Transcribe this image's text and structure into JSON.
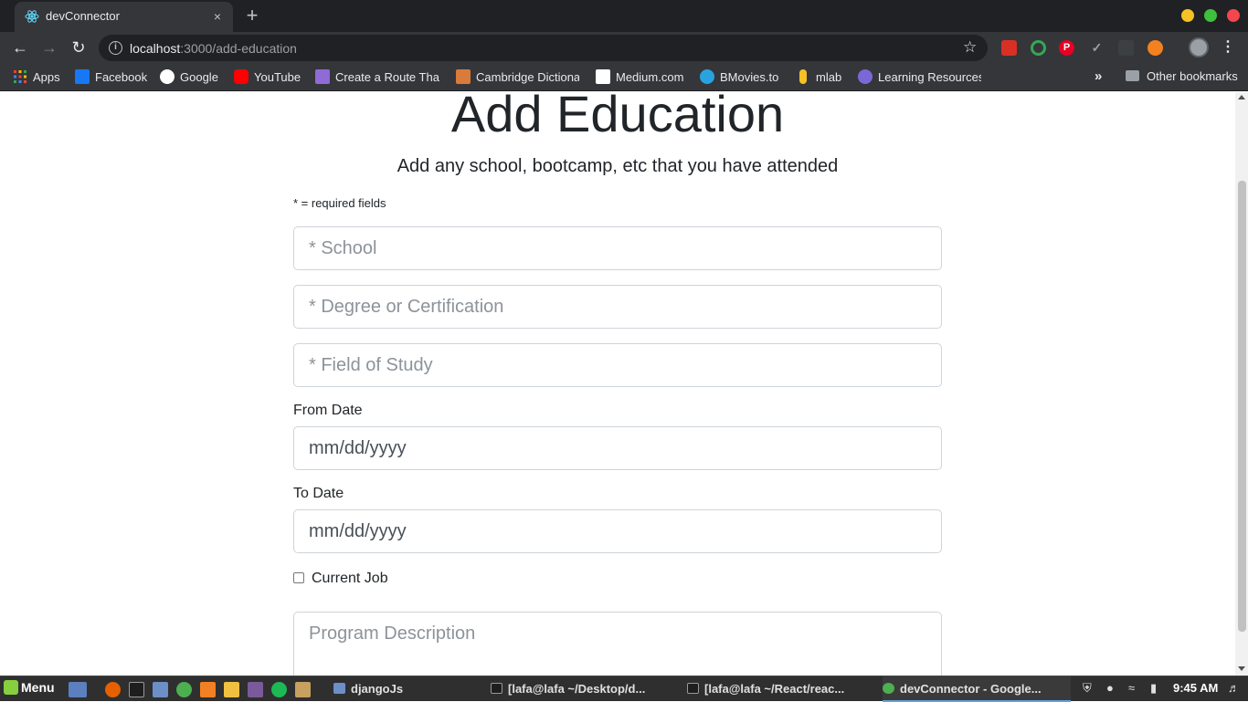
{
  "browser": {
    "tab_title": "devConnector",
    "tab_close": "×",
    "new_tab": "+",
    "url_host": "localhost",
    "url_rest": ":3000/add-education",
    "icons": {
      "back": "arrow-left",
      "forward": "arrow-right",
      "reload": "reload",
      "star": "star",
      "menu": "kebab"
    }
  },
  "bookmarks": [
    {
      "label": "Apps",
      "icon_color": "#ea4335"
    },
    {
      "label": "Facebook",
      "icon_color": "#1877f2"
    },
    {
      "label": "Google",
      "icon_color": "#ffffff"
    },
    {
      "label": "YouTube",
      "icon_color": "#ff0000"
    },
    {
      "label": "Create a Route That",
      "icon_color": "#8e6bd6"
    },
    {
      "label": "Cambridge Dictiona",
      "icon_color": "#d97b3a"
    },
    {
      "label": "Medium.com",
      "icon_color": "#ffffff"
    },
    {
      "label": "BMovies.to",
      "icon_color": "#29a3e0"
    },
    {
      "label": "mlab",
      "icon_color": "#f5c225"
    },
    {
      "label": "Learning Resources",
      "icon_color": "#7b68d6"
    }
  ],
  "bookmarks_more": "»",
  "bookmarks_other": "Other bookmarks",
  "page": {
    "heading": "Add Education",
    "lead": "Add any school, bootcamp, etc that you have attended",
    "required_note": "* = required fields",
    "school_placeholder": "* School",
    "degree_placeholder": "* Degree or Certification",
    "field_of_study_placeholder": "* Field of Study",
    "from_label": "From Date",
    "from_value": "mm/dd/yyyy",
    "to_label": "To Date",
    "to_value": "mm/dd/yyyy",
    "current_label": "Current Job",
    "current_checked": false,
    "description_placeholder": "Program Description"
  },
  "taskbar": {
    "menu_label": "Menu",
    "windows": [
      {
        "label": "djangoJs",
        "active": false
      },
      {
        "label": "[lafa@lafa ~/Desktop/d...",
        "active": false
      },
      {
        "label": "[lafa@lafa ~/React/reac...",
        "active": false
      },
      {
        "label": "devConnector - Google...",
        "active": true
      }
    ],
    "clock": "9:45 AM"
  }
}
